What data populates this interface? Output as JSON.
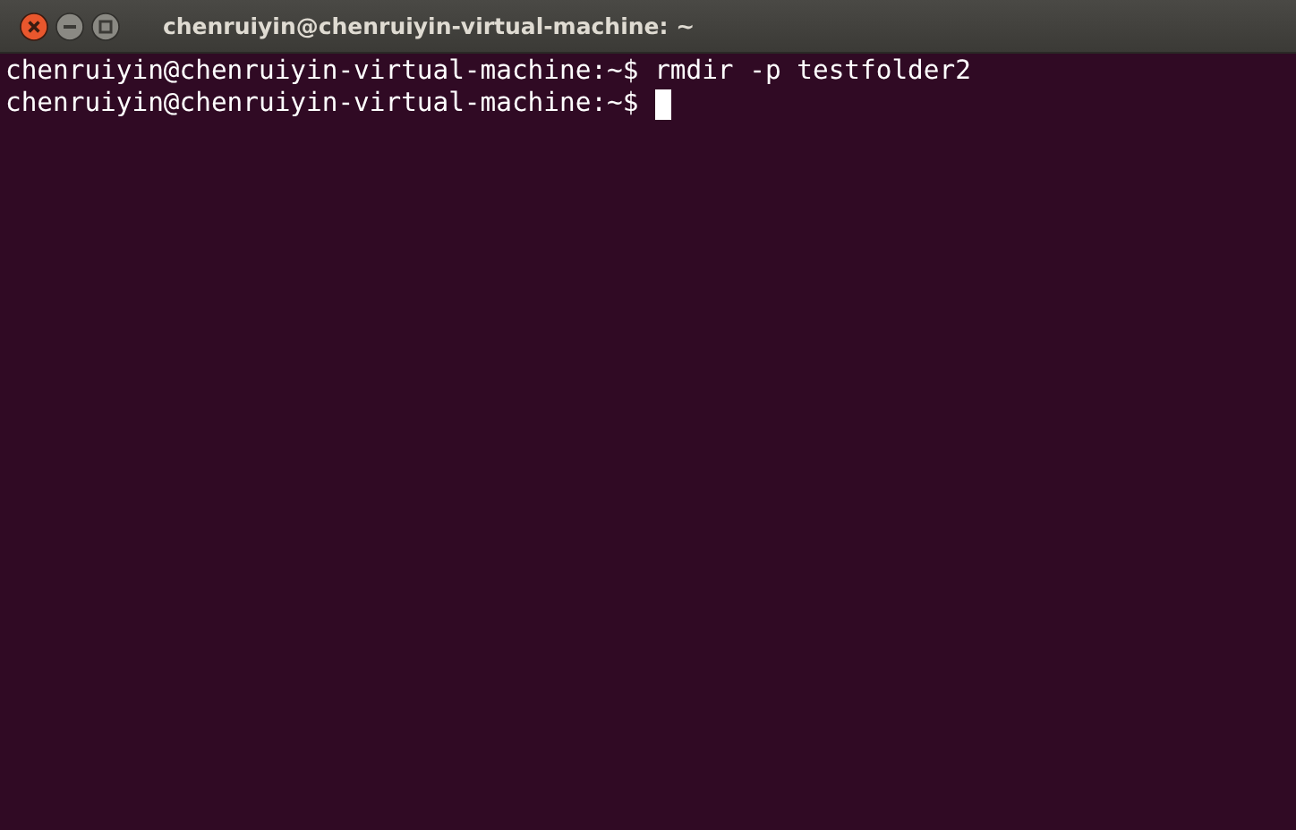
{
  "window": {
    "title": "chenruiyin@chenruiyin-virtual-machine: ~"
  },
  "terminal": {
    "lines": [
      {
        "prompt": "chenruiyin@chenruiyin-virtual-machine:~$",
        "command": "rmdir -p testfolder2",
        "cursor": false
      },
      {
        "prompt": "chenruiyin@chenruiyin-virtual-machine:~$",
        "cursor": true
      }
    ]
  }
}
